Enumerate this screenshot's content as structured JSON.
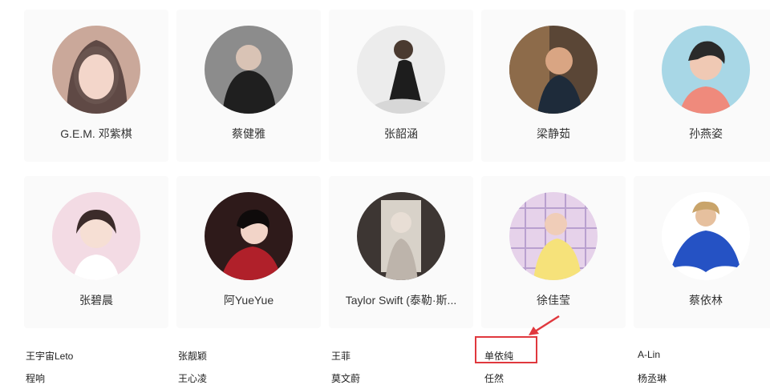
{
  "cards": [
    {
      "name": "G.E.M. 邓紫棋",
      "avatar_icon": "portrait-photo"
    },
    {
      "name": "蔡健雅",
      "avatar_icon": "portrait-photo"
    },
    {
      "name": "张韶涵",
      "avatar_icon": "portrait-photo"
    },
    {
      "name": "梁静茹",
      "avatar_icon": "portrait-photo"
    },
    {
      "name": "孙燕姿",
      "avatar_icon": "portrait-photo"
    },
    {
      "name": "张碧晨",
      "avatar_icon": "portrait-photo"
    },
    {
      "name": "阿YueYue",
      "avatar_icon": "portrait-photo"
    },
    {
      "name": "Taylor Swift (泰勒·斯...",
      "avatar_icon": "portrait-photo"
    },
    {
      "name": "徐佳莹",
      "avatar_icon": "portrait-photo"
    },
    {
      "name": "蔡依林",
      "avatar_icon": "portrait-photo"
    }
  ],
  "artist_links": {
    "row1": [
      "王宇宙Leto",
      "张靓颖",
      "王菲",
      "单依纯",
      "A-Lin"
    ],
    "row2": [
      "程响",
      "王心凌",
      "莫文蔚",
      "任然",
      "杨丞琳"
    ]
  },
  "annotation": {
    "highlighted": "单依纯",
    "color": "#e0383e"
  }
}
